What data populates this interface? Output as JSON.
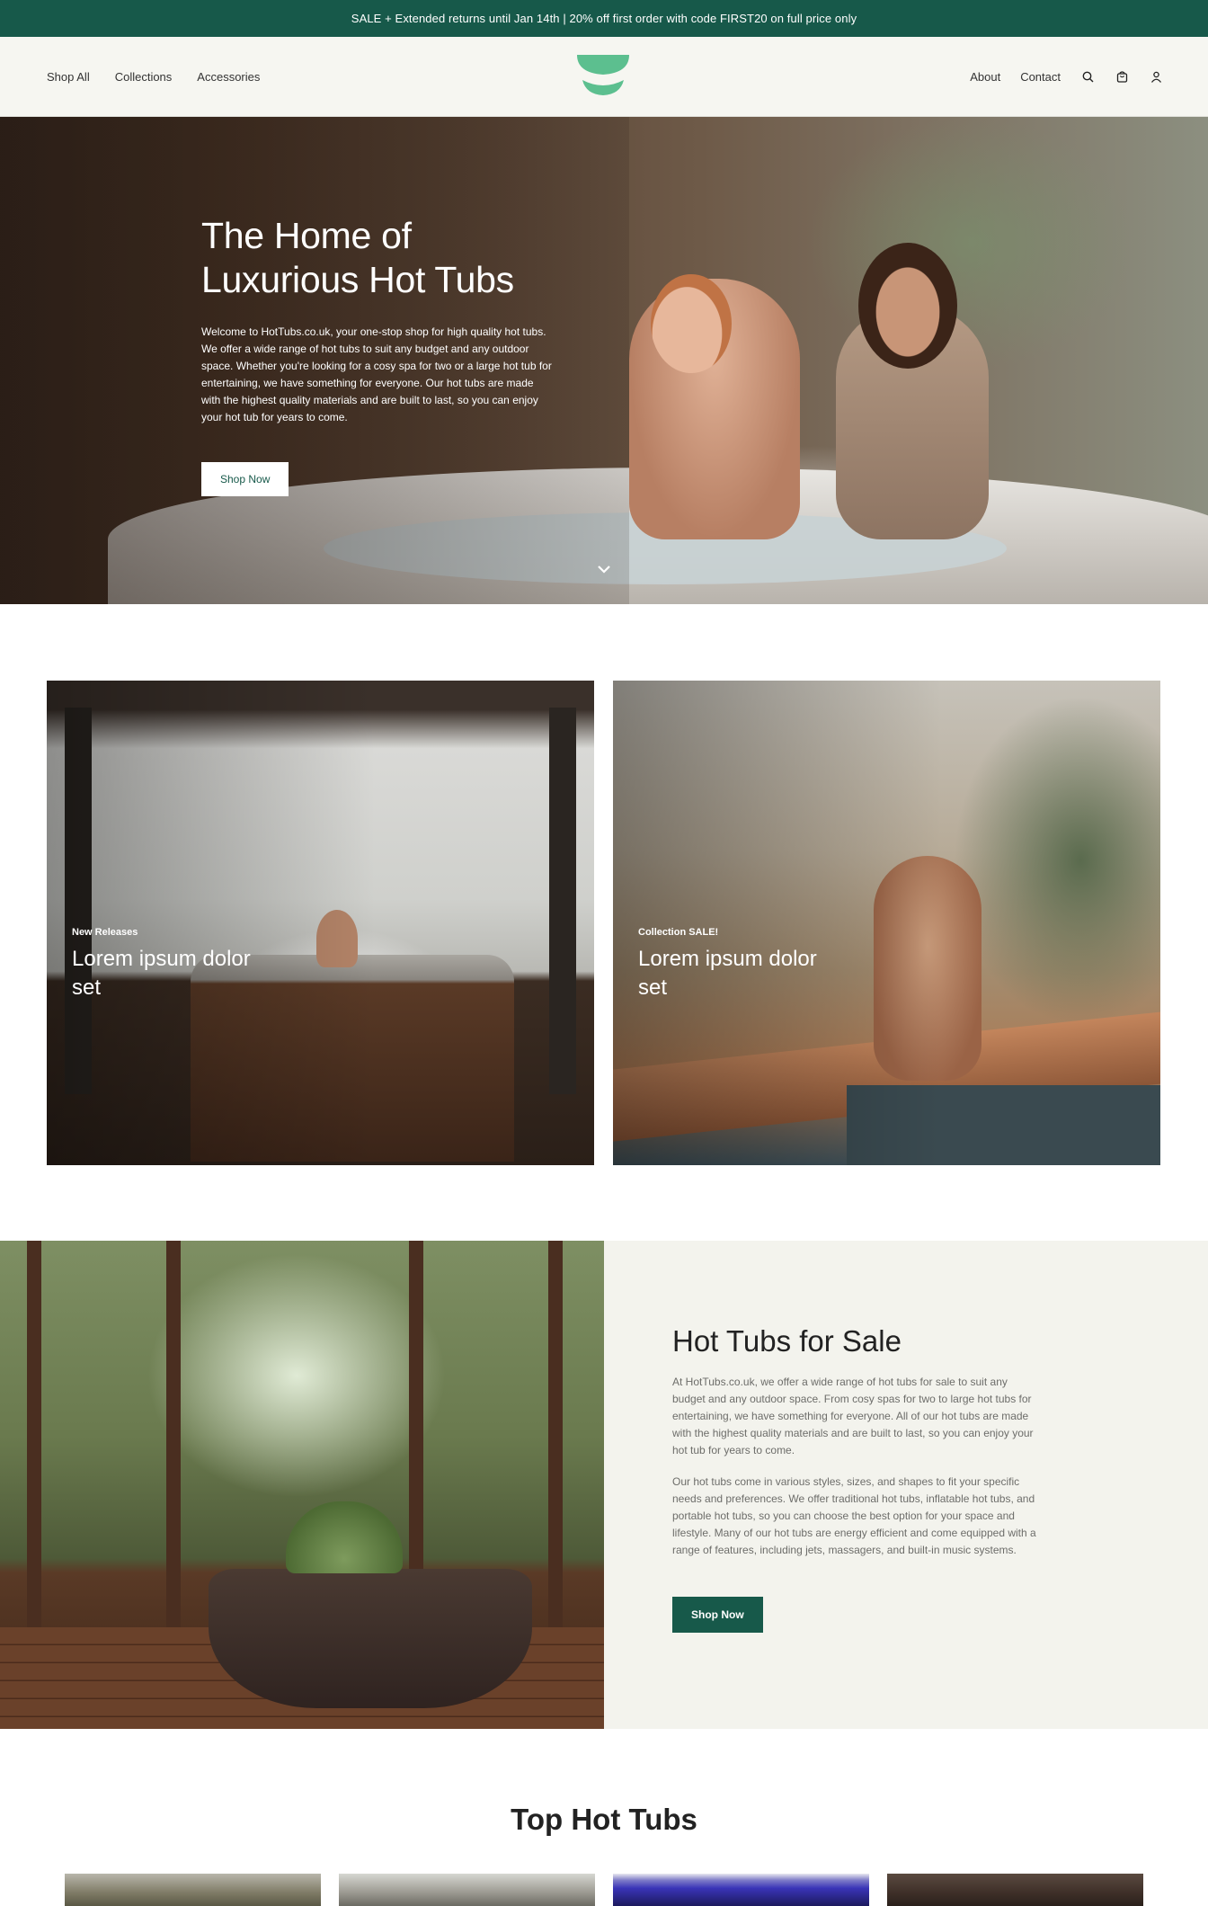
{
  "announcement": "SALE + Extended returns until Jan 14th | 20% off first order with code FIRST20 on full price only",
  "header": {
    "nav_left": [
      "Shop All",
      "Collections",
      "Accessories"
    ],
    "nav_right": [
      "About",
      "Contact"
    ],
    "icons": [
      "search-icon",
      "cart-icon",
      "account-icon"
    ],
    "brand_color": "#17594a",
    "logo_color": "#5cbf8f"
  },
  "hero": {
    "title_line1": "The Home of",
    "title_line2": "Luxurious Hot Tubs",
    "text": "Welcome to HotTubs.co.uk, your one-stop shop for high quality hot tubs. We offer a wide range of hot tubs to suit any budget and any outdoor space. Whether you're looking for a cosy spa for two or a large hot tub for entertaining, we have something for everyone. Our hot tubs are made with the highest quality materials and are built to last, so you can enjoy your hot tub for years to come.",
    "button": "Shop Now",
    "scroll_icon": "chevron-down-icon"
  },
  "cards": [
    {
      "eyebrow": "New Releases",
      "title": "Lorem ipsum dolor set"
    },
    {
      "eyebrow": "Collection SALE!",
      "title": "Lorem ipsum dolor set"
    }
  ],
  "feature": {
    "title": "Hot Tubs for Sale",
    "paragraph1": "At HotTubs.co.uk, we offer a wide range of hot tubs for sale to suit any budget and any outdoor space. From cosy spas for two to large hot tubs for entertaining, we have something for everyone. All of our hot tubs are made with the highest quality materials and are built to last, so you can enjoy your hot tub for years to come.",
    "paragraph2": "Our hot tubs come in various styles, sizes, and shapes to fit your specific needs and preferences. We offer traditional hot tubs, inflatable hot tubs, and portable hot tubs, so you can choose the best option for your space and lifestyle. Many of our hot tubs are energy efficient and come equipped with a range of features, including jets, massagers, and built-in music systems.",
    "button": "Shop Now"
  },
  "top_section": {
    "title": "Top Hot Tubs"
  }
}
